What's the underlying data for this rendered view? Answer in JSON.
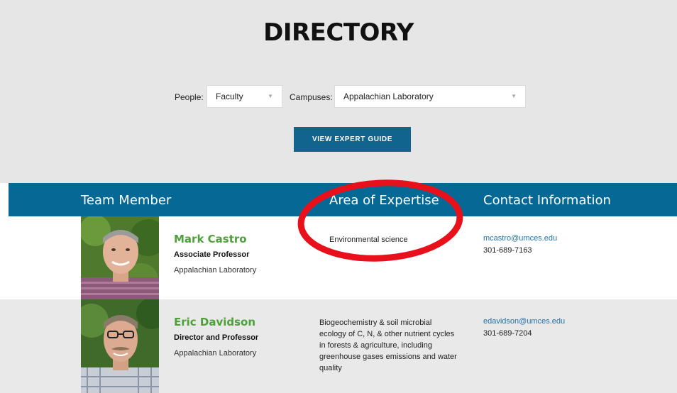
{
  "page": {
    "title": "DIRECTORY"
  },
  "filters": {
    "people_label": "People:",
    "people_value": "Faculty",
    "campuses_label": "Campuses:",
    "campuses_value": "Appalachian Laboratory",
    "caret": "▼"
  },
  "button": {
    "label": "VIEW EXPERT GUIDE"
  },
  "table": {
    "headers": [
      "Team Member",
      "Area of Expertise",
      "Contact Information"
    ],
    "rows": [
      {
        "name": "Mark Castro",
        "role": "Associate Professor",
        "campus": "Appalachian Laboratory",
        "expertise": "Environmental science",
        "email": "mcastro@umces.edu",
        "phone": "301-689-7163"
      },
      {
        "name": "Eric Davidson",
        "role": "Director and Professor",
        "campus": "Appalachian Laboratory",
        "expertise": "Biogeochemistry & soil microbial ecology of C, N, & other nutrient cycles in forests & agriculture, including greenhouse gases emissions and water quality",
        "email": "edavidson@umces.edu",
        "phone": "301-689-7204"
      }
    ]
  },
  "colors": {
    "accent": "#066894",
    "button": "#11648e",
    "name_green": "#4ea13a",
    "annotation_red": "#e8101a"
  }
}
